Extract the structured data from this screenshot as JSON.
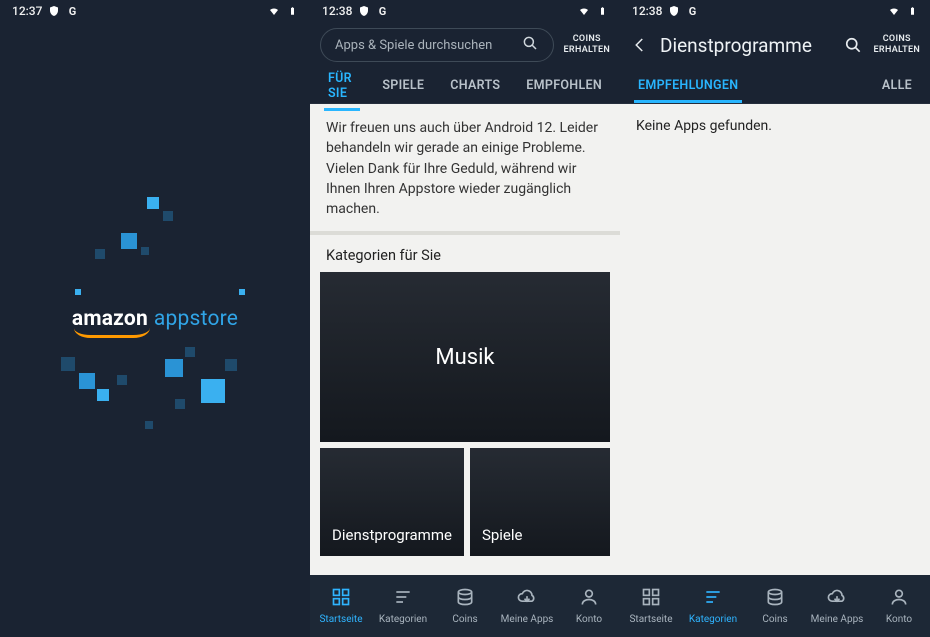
{
  "status": {
    "left": {
      "time": "12:37"
    },
    "mid": {
      "time": "12:38"
    },
    "right": {
      "time": "12:38"
    }
  },
  "left": {
    "brand_prefix": "amazon",
    "brand_suffix": "appstore"
  },
  "mid": {
    "search_placeholder": "Apps & Spiele durchsuchen",
    "coins_l1": "COINS",
    "coins_l2": "ERHALTEN",
    "tabs": {
      "fuer_sie": "FÜR SIE",
      "spiele": "SPIELE",
      "charts": "CHARTS",
      "empfohlen": "EMPFOHLEN"
    },
    "message": "Wir freuen uns auch über Android 12. Leider behandeln wir gerade an einige Probleme. Vielen Dank für Ihre Geduld, während wir Ihnen Ihren Appstore wieder zugänglich machen.",
    "categories_heading": "Kategorien für Sie",
    "cat_big": "Musik",
    "cat_small_a": "Dienstprogramme",
    "cat_small_b": "Spiele"
  },
  "right": {
    "page_title": "Dienstprogramme",
    "coins_l1": "COINS",
    "coins_l2": "ERHALTEN",
    "tabs": {
      "empfehlungen": "EMPFEHLUNGEN",
      "alle": "ALLE"
    },
    "empty": "Keine Apps gefunden."
  },
  "nav": {
    "startseite": "Startseite",
    "kategorien": "Kategorien",
    "coins": "Coins",
    "meine_apps": "Meine Apps",
    "konto": "Konto"
  }
}
